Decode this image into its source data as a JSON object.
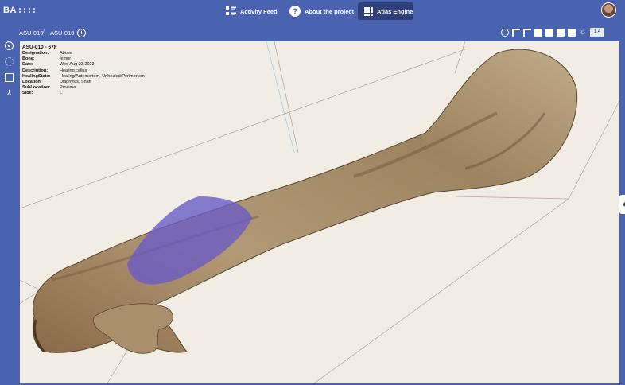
{
  "header": {
    "logo_text": "BA",
    "nav": [
      {
        "label": "Activity Feed",
        "icon": "feed-icon"
      },
      {
        "label": "About the project",
        "icon": "question-icon"
      },
      {
        "label": "Atlas Engine",
        "icon": "grid-icon",
        "active": true
      }
    ]
  },
  "subbar": {
    "breadcrumbs": [
      "ASU-010",
      "ASU-010"
    ],
    "zoom_value": "1.4"
  },
  "specimen": {
    "title": "ASU-010 - 67F",
    "fields": [
      {
        "key": "Designation:",
        "value": "Abuse"
      },
      {
        "key": "Bone:",
        "value": "femur"
      },
      {
        "key": "Date:",
        "value": "Wed Aug 23 2023"
      },
      {
        "key": "Description:",
        "value": "Healing callus"
      },
      {
        "key": "HealingState:",
        "value": "Healing/Antemortem, Unhealed/Perimortem"
      },
      {
        "key": "Location:",
        "value": "Diaphysis, Shaft"
      },
      {
        "key": "SubLocation:",
        "value": "Proximal"
      },
      {
        "key": "Side:",
        "value": "L"
      }
    ]
  },
  "colors": {
    "brand": "#4a63b0",
    "active_nav": "#2e3f79",
    "viewport_bg": "#f1ede4",
    "highlight": "#6a5bc4"
  }
}
